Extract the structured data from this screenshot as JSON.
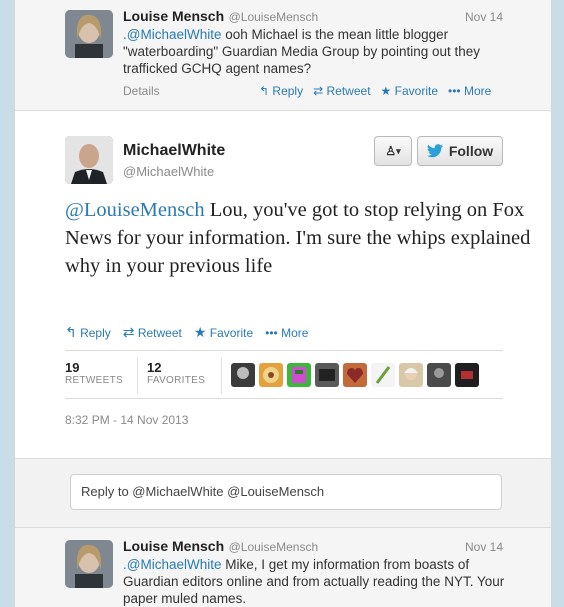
{
  "tweet1": {
    "name": "Louise Mensch",
    "handle": "@LouiseMensch",
    "date": "Nov 14",
    "mention": ".@MichaelWhite",
    "text": " ooh Michael is the mean little blogger \"waterboarding\" Guardian Media Group by pointing out they trafficked GCHQ agent names?",
    "details": "Details",
    "actions": {
      "reply": "Reply",
      "retweet": "Retweet",
      "favorite": "Favorite",
      "more": "More"
    }
  },
  "main": {
    "name": "MichaelWhite",
    "handle": "@MichaelWhite",
    "follow_label": "Follow",
    "mention": "@LouiseMensch",
    "text": " Lou, you've got to stop relying on Fox News for your information. I'm sure the whips explained why in your previous life",
    "actions": {
      "reply": "Reply",
      "retweet": "Retweet",
      "favorite": "Favorite",
      "more": "More"
    },
    "retweets_count": "19",
    "retweets_label": "RETWEETS",
    "favorites_count": "12",
    "favorites_label": "FAVORITES",
    "timestamp": "8:32 PM - 14 Nov 2013",
    "reply_placeholder": "Reply to @MichaelWhite @LouiseMensch"
  },
  "tweet2": {
    "name": "Louise Mensch",
    "handle": "@LouiseMensch",
    "date": "Nov 14",
    "mention": ".@MichaelWhite",
    "text": " Mike, I get my information from boasts of Guardian editors online and from actually reading the NYT. Your paper muled names."
  },
  "colors": {
    "link": "#2a7bb3",
    "twitter_bird": "#2a9fd8",
    "background": "#c9dde9"
  }
}
